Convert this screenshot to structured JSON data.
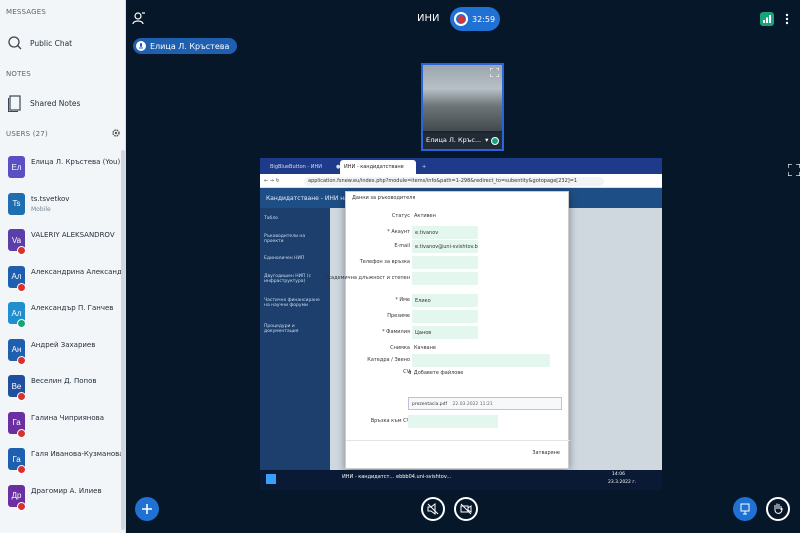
{
  "sidebar": {
    "messages_title": "MESSAGES",
    "public_chat": "Public Chat",
    "notes_title": "NOTES",
    "shared_notes": "Shared Notes",
    "users_title": "USERS (27)",
    "users": [
      {
        "initials": "Ел",
        "name": "Елица Л. Кръстева (You)",
        "sub": "",
        "color": "#5b4fc4",
        "mic": ""
      },
      {
        "initials": "Ts",
        "name": "ts.tsvetkov",
        "sub": "Mobile",
        "color": "#1f6fb0",
        "mic": ""
      },
      {
        "initials": "Va",
        "name": "VALERIY ALEKSANDROV",
        "sub": "",
        "color": "#5b3fa8",
        "mic": "#d93030"
      },
      {
        "initials": "Ал",
        "name": "Александрина Александрова",
        "sub": "",
        "color": "#1f5fb0",
        "mic": "#d93030"
      },
      {
        "initials": "Ал",
        "name": "Александър П. Ганчев",
        "sub": "",
        "color": "#1f8fd0",
        "mic": "#1aa37a"
      },
      {
        "initials": "Ан",
        "name": "Андрей Захариев",
        "sub": "",
        "color": "#1f5fb0",
        "mic": "#d93030"
      },
      {
        "initials": "Ве",
        "name": "Веселин Д. Попов",
        "sub": "",
        "color": "#1f4f9f",
        "mic": "#d93030"
      },
      {
        "initials": "Га",
        "name": "Галина Чиприянова",
        "sub": "",
        "color": "#6a2fa0",
        "mic": "#d93030"
      },
      {
        "initials": "Га",
        "name": "Галя Иванова-Кузманова",
        "sub": "",
        "color": "#1f5fb0",
        "mic": "#d93030"
      },
      {
        "initials": "Др",
        "name": "Драгомир А. Илиев",
        "sub": "",
        "color": "#6a2fa0",
        "mic": "#d93030"
      }
    ]
  },
  "topbar": {
    "title": "ИНИ",
    "timer": "32:59",
    "presenter": "Елица Л. Кръстева"
  },
  "webcam": {
    "caption": "Елица Л. Кръс..."
  },
  "screen": {
    "tabs": [
      "BigBlueButton - ИНИ",
      "ИНИ - кандидатстване",
      "application.fsnew.eu"
    ],
    "url": "application.fsnew.eu/index.php?module=items/info&path=1-298&redirect_to=subentity&gotopage[232]=1",
    "app_title": "Кандидатстване - ИНИ на СА \"Д. А...",
    "side_items": [
      "Табло",
      "Ръководители на проекти",
      "Единоличен НИП",
      "Двугодишен НИП (с инфраструктура)",
      "Частично финансиране на научни форуми",
      "Процедури и документация"
    ],
    "modal_header": "Данни за ръководителя",
    "fields": [
      {
        "label": "Статус",
        "value": "Активен",
        "style": "plain"
      },
      {
        "label": "* Акаунт",
        "value": "e.tivanov",
        "style": "box"
      },
      {
        "label": "E-mail",
        "value": "e.tivanov@uni-svishtov.bg",
        "style": "box"
      },
      {
        "label": "Телефон за връзка",
        "value": "",
        "style": "box"
      },
      {
        "label": "Академична длъжност и степен",
        "value": "",
        "style": "box"
      },
      {
        "label": "* Име",
        "value": "Елико",
        "style": "box"
      },
      {
        "label": "Презиме",
        "value": "",
        "style": "box"
      },
      {
        "label": "* Фамилия",
        "value": "Цанов",
        "style": "box"
      },
      {
        "label": "Снимка",
        "value": "Качване",
        "style": "plain"
      },
      {
        "label": "Катедра / Звено",
        "value": "",
        "style": "wide"
      }
    ],
    "cv_label": "CV",
    "add_files": "Добавете файлове",
    "file_name": "prezentacia.pdf",
    "file_date": "22.03.2022 11:21",
    "cv_link_label": "Връзка към CV",
    "close_label": "Затваряне",
    "taskbar_items": [
      "ИНИ - кандидатст...",
      "ebbb04.uni-svishtov..."
    ],
    "clock_time": "14:06",
    "clock_date": "23.3.2022 г."
  }
}
